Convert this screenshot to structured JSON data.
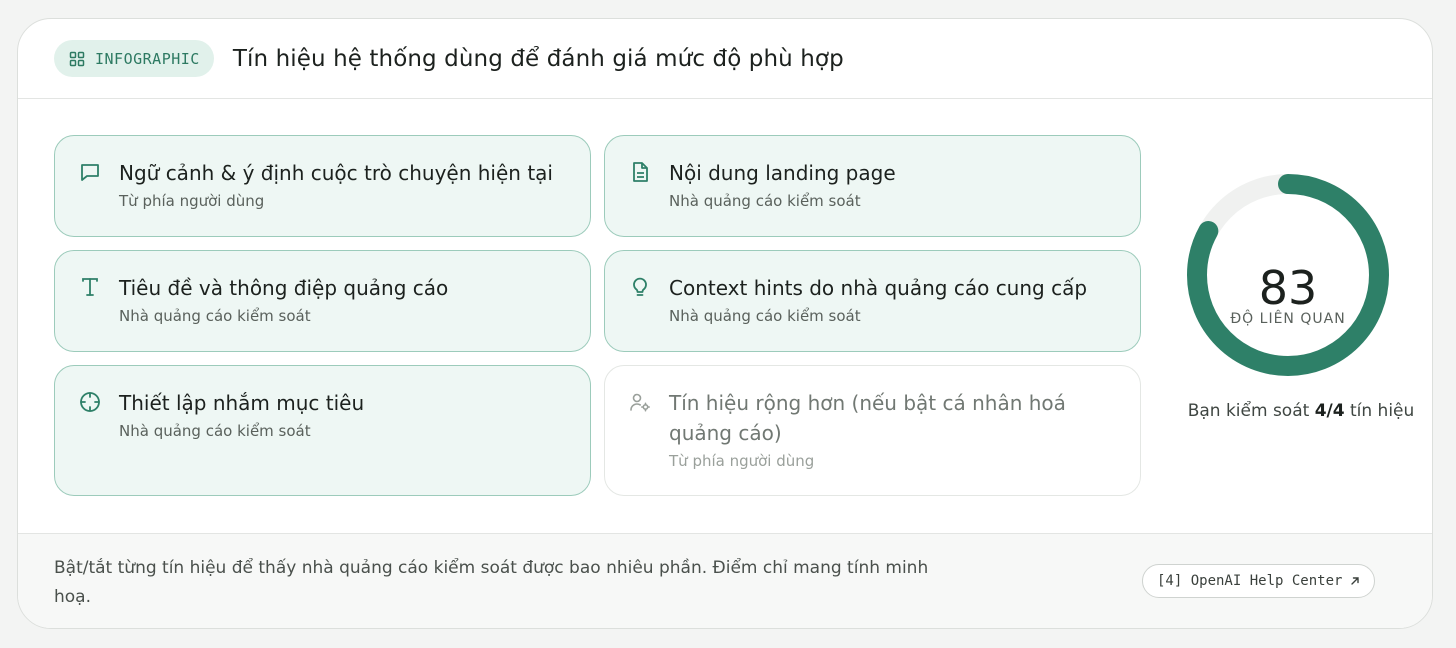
{
  "header": {
    "badge_label": "INFOGRAPHIC",
    "badge_icon": "grid-icon",
    "title": "Tín hiệu hệ thống dùng để đánh giá mức độ phù hợp"
  },
  "signals": [
    {
      "title": "Ngữ cảnh & ý định cuộc trò chuyện hiện tại",
      "subtitle": "Từ phía người dùng",
      "icon": "chat-bubble-icon",
      "enabled": true
    },
    {
      "title": "Nội dung landing page",
      "subtitle": "Nhà quảng cáo kiểm soát",
      "icon": "document-icon",
      "enabled": true
    },
    {
      "title": "Tiêu đề và thông điệp quảng cáo",
      "subtitle": "Nhà quảng cáo kiểm soát",
      "icon": "text-icon",
      "enabled": true
    },
    {
      "title": "Context hints do nhà quảng cáo cung cấp",
      "subtitle": "Nhà quảng cáo kiểm soát",
      "icon": "lightbulb-icon",
      "enabled": true
    },
    {
      "title": "Thiết lập nhắm mục tiêu",
      "subtitle": "Nhà quảng cáo kiểm soát",
      "icon": "target-icon",
      "enabled": true
    },
    {
      "title": "Tín hiệu rộng hơn (nếu bật cá nhân hoá quảng cáo)",
      "subtitle": "Từ phía người dùng",
      "icon": "user-settings-icon",
      "enabled": false
    }
  ],
  "gauge": {
    "value": "83",
    "fraction": 0.83,
    "label": "ĐỘ LIÊN QUAN",
    "color": "#2e8068",
    "track_color": "#f0f1f0"
  },
  "control": {
    "prefix": "Bạn kiểm soát ",
    "count": "4/4",
    "suffix": " tín hiệu"
  },
  "footer": {
    "note": "Bật/tắt từng tín hiệu để thấy nhà quảng cáo kiểm soát được bao nhiêu phần. Điểm chỉ mang tính minh hoạ.",
    "link_label": "[4] OpenAI Help Center",
    "link_icon": "external-arrow-icon"
  },
  "colors": {
    "accent": "#2e8068",
    "tile_active_bg": "#eef7f4",
    "tile_active_border": "#9ccbbb"
  }
}
